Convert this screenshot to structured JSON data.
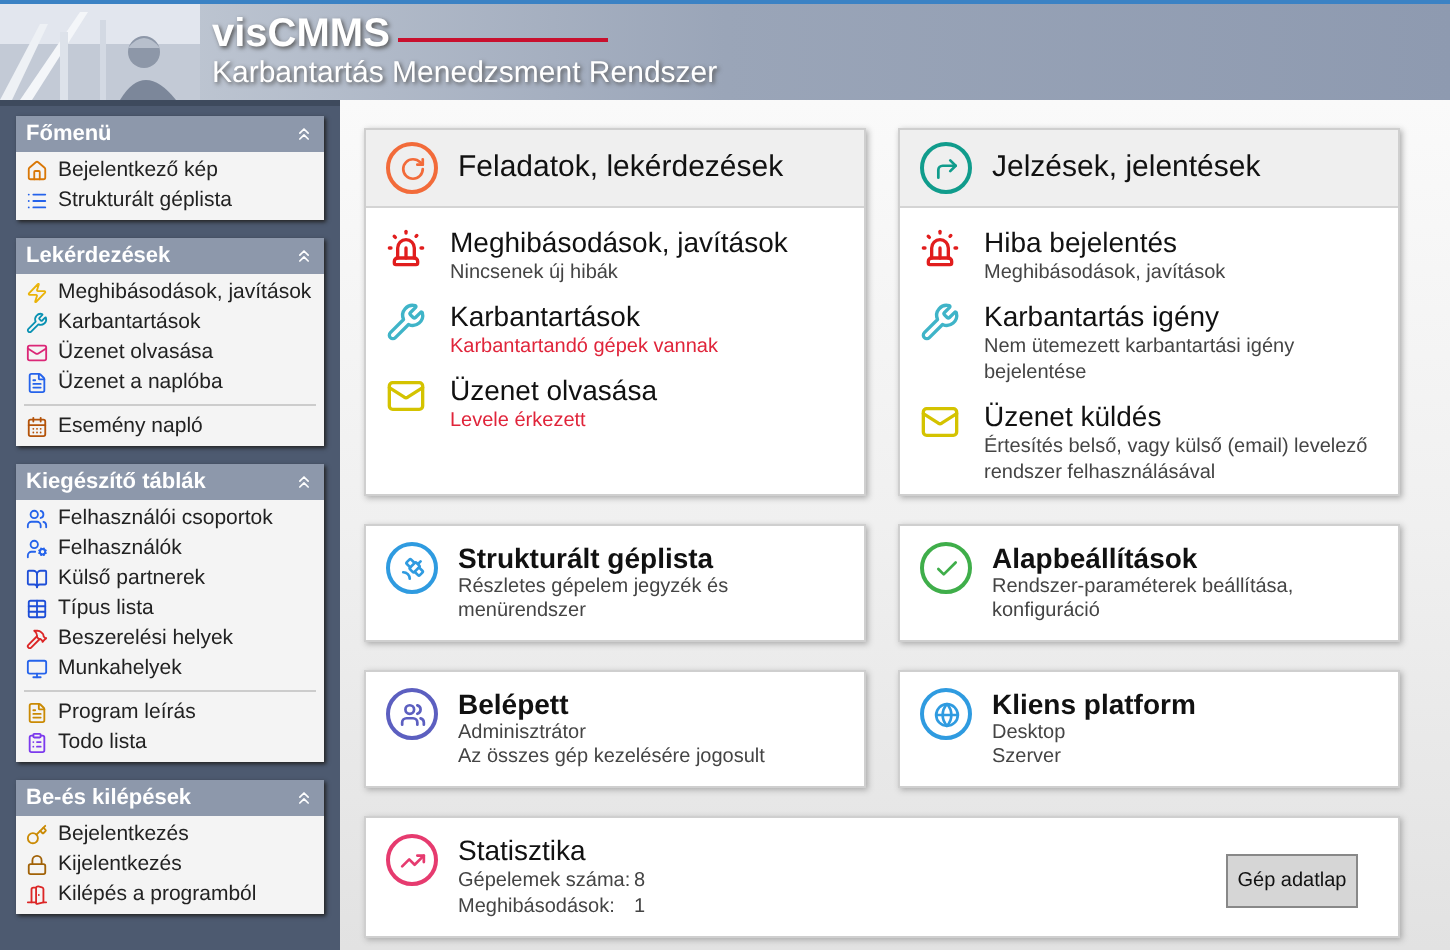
{
  "header": {
    "title": "visCMMS",
    "subtitle": "Karbantartás Menedzsment Rendszer"
  },
  "sidebar": {
    "groups": [
      {
        "title": "Főmenü",
        "sections": [
          [
            {
              "label": "Bejelentkező kép"
            },
            {
              "label": "Strukturált géplista"
            }
          ]
        ]
      },
      {
        "title": "Lekérdezések",
        "sections": [
          [
            {
              "label": "Meghibásodások, javítások"
            },
            {
              "label": "Karbantartások"
            },
            {
              "label": "Üzenet olvasása"
            },
            {
              "label": "Üzenet a naplóba"
            }
          ],
          [
            {
              "label": "Esemény napló"
            }
          ]
        ]
      },
      {
        "title": "Kiegészítő táblák",
        "sections": [
          [
            {
              "label": "Felhasználói csoportok"
            },
            {
              "label": "Felhasználók"
            },
            {
              "label": "Külső partnerek"
            },
            {
              "label": "Típus lista"
            },
            {
              "label": "Beszerelési helyek"
            },
            {
              "label": "Munkahelyek"
            }
          ],
          [
            {
              "label": "Program leírás"
            },
            {
              "label": "Todo lista"
            }
          ]
        ]
      },
      {
        "title": "Be-és kilépések",
        "sections": [
          [
            {
              "label": "Bejelentkezés"
            },
            {
              "label": "Kijelentkezés"
            },
            {
              "label": "Kilépés a programból"
            }
          ]
        ]
      }
    ]
  },
  "panels": [
    {
      "title": "Feladatok, lekérdezések",
      "entries": [
        {
          "title": "Meghibásodások, javítások",
          "detail": "Nincsenek új hibák",
          "alert": false
        },
        {
          "title": "Karbantartások",
          "detail": "Karbantartandó gépek vannak",
          "alert": true
        },
        {
          "title": "Üzenet olvasása",
          "detail": "Levele érkezett",
          "alert": true
        }
      ]
    },
    {
      "title": "Jelzések, jelentések",
      "entries": [
        {
          "title": "Hiba bejelentés",
          "detail": "Meghibásodások, javítások",
          "alert": false
        },
        {
          "title": "Karbantartás igény",
          "detail": "Nem ütemezett karbantartási igény bejelentése",
          "alert": false
        },
        {
          "title": "Üzenet küldés",
          "detail": "Értesítés belső, vagy külső (email) levelező rendszer felhasználásával",
          "alert": false
        }
      ]
    }
  ],
  "cards": [
    {
      "title": "Strukturált géplista",
      "lines": [
        "Részletes gépelem jegyzék és menürendszer"
      ]
    },
    {
      "title": "Alapbeállítások",
      "lines": [
        "Rendszer-paraméterek beállítása, konfiguráció"
      ]
    },
    {
      "title": "Belépett",
      "lines": [
        "Adminisztrátor",
        "Az összes gép kezelésére jogosult"
      ]
    },
    {
      "title": "Kliens platform",
      "lines": [
        "Desktop",
        "Szerver"
      ]
    }
  ],
  "statistics": {
    "title": "Statisztika",
    "rows": [
      {
        "label": "Gépelemek száma:",
        "value": "8"
      },
      {
        "label": "Meghibásodások:",
        "value": "1"
      }
    ],
    "button": "Gép adatlap"
  }
}
